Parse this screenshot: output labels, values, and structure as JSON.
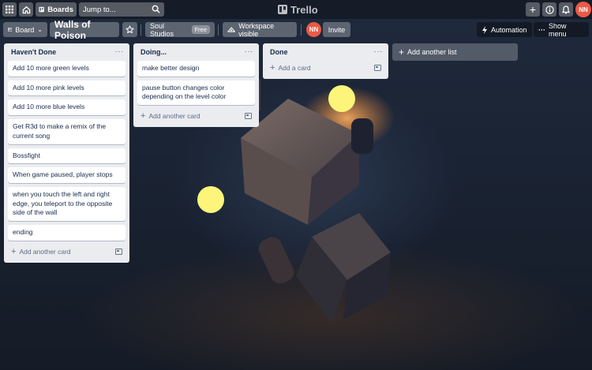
{
  "topbar": {
    "boards_label": "Boards",
    "search_placeholder": "Jump to...",
    "logo_text": "Trello",
    "avatar_initials": "NN"
  },
  "board": {
    "view_label": "Board",
    "title": "Walls of Poison",
    "workspace_name": "Soul Studios",
    "workspace_badge": "Free",
    "visibility_label": "Workspace visible",
    "member_initials": "NN",
    "invite_label": "Invite",
    "automation_label": "Automation",
    "show_menu_label": "Show menu"
  },
  "lists": [
    {
      "title": "Haven't Done",
      "cards": [
        "Add 10 more green levels",
        "Add 10 more pink levels",
        "Add 10 more blue levels",
        "Get R3d to make a remix of the current song",
        "Bossfight",
        "When game paused, player stops",
        "when you touch the left and right edge, you teleport to the opposite side of the wall",
        "ending"
      ],
      "add_label": "Add another card"
    },
    {
      "title": "Doing...",
      "cards": [
        "make better design",
        "pause button changes color depending on the level color"
      ],
      "add_label": "Add another card"
    },
    {
      "title": "Done",
      "cards": [],
      "add_label": "Add a card"
    }
  ],
  "add_list_label": "Add another list",
  "colors": {
    "accent_avatar": "#eb5a46",
    "list_bg": "#ebecf0",
    "yellow_dot": "#fcf57a"
  }
}
